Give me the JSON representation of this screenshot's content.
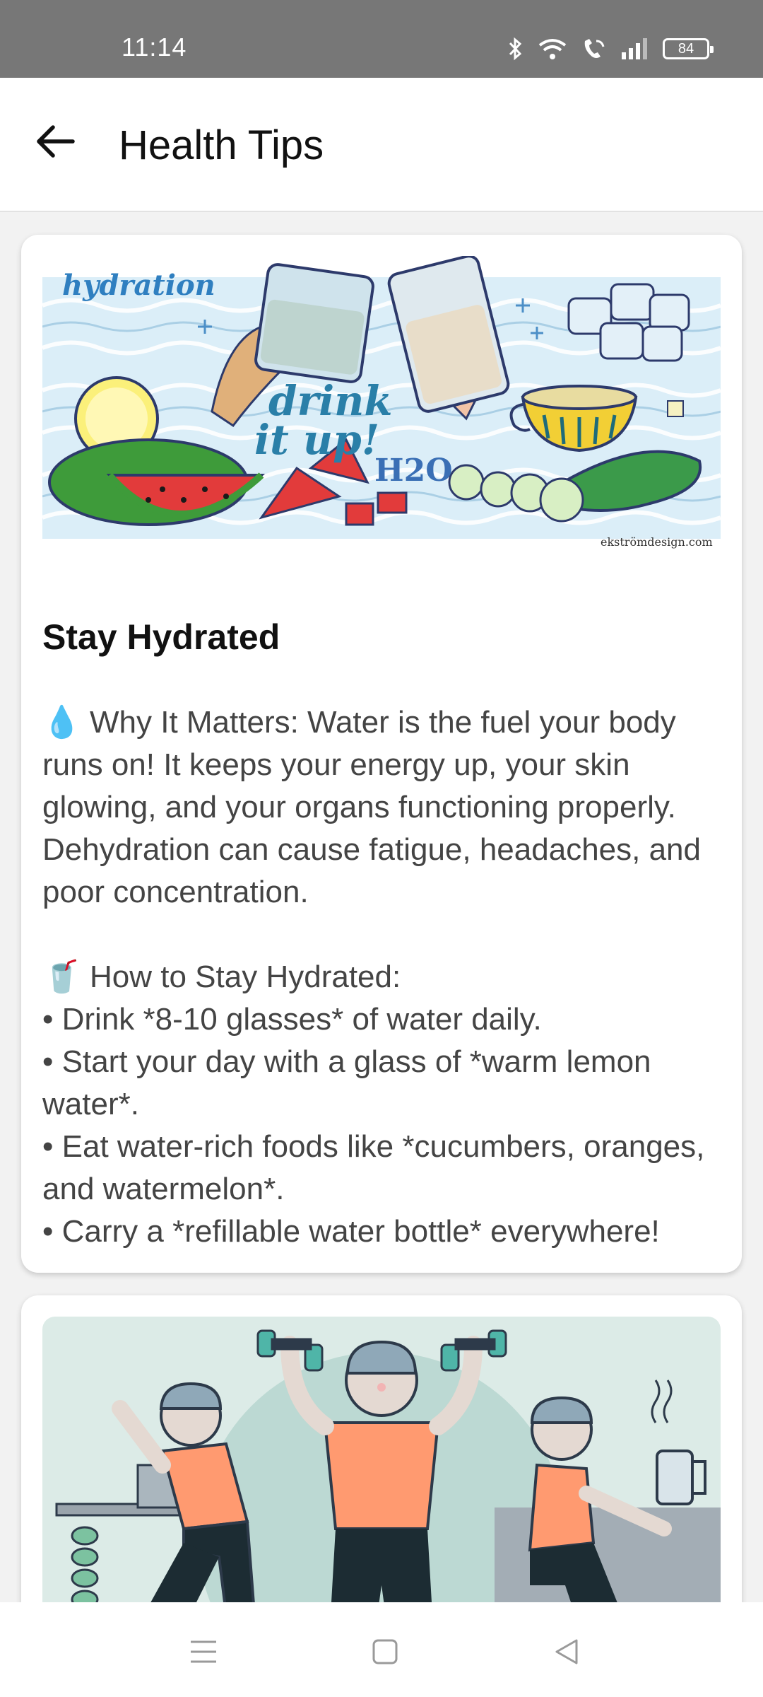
{
  "status_bar": {
    "time": "11:14",
    "battery": "84",
    "icons": [
      "bluetooth-icon",
      "wifi-icon",
      "wifi-calling-icon",
      "signal-icon",
      "battery-icon"
    ]
  },
  "header": {
    "title": "Health Tips",
    "back_icon": "arrow-left-icon"
  },
  "cards": [
    {
      "image": {
        "alt_icon": "hydration-illustration",
        "texts": {
          "hydration": "hydration",
          "drink": "drink",
          "it_up": "it up!",
          "h2o": "H2O",
          "credit": "ekströmdesign.com"
        }
      },
      "title": "Stay Hydrated",
      "body": "💧 Why It Matters: Water is the fuel your body runs on! It keeps your energy up, your skin glowing, and your organs functioning properly. Dehydration can cause fatigue, headaches, and poor concentration.\n\n🥤 How to Stay Hydrated:\n• Drink *8-10 glasses* of water daily.\n• Start your day with a glass of *warm lemon water*.\n• Eat water-rich foods like *cucumbers, oranges, and watermelon*.\n• Carry a *refillable water bottle* everywhere!"
    },
    {
      "image": {
        "alt_icon": "exercise-illustration"
      }
    }
  ],
  "nav_bar": {
    "icons": [
      "menu-icon",
      "home-square-icon",
      "back-triangle-icon"
    ]
  },
  "colors": {
    "status_bar": "#777777",
    "app_bar": "#ffffff",
    "page_bg": "#f2f2f2",
    "exercise_shirt": "#ff9a70",
    "exercise_bg": "#d8ebe6"
  }
}
